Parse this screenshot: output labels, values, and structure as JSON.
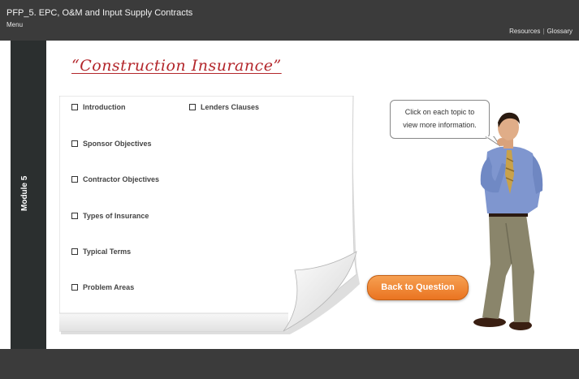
{
  "header": {
    "course_title": "PFP_5.  EPC, O&M and Input Supply Contracts",
    "menu_label": "Menu",
    "resources_label": "Resources",
    "separator": "|",
    "glossary_label": "Glossary"
  },
  "module": {
    "label": "Module 5"
  },
  "page": {
    "heading": "“Construction Insurance”"
  },
  "topics_col1": [
    "Introduction",
    "Sponsor Objectives",
    "Contractor Objectives",
    "Types of Insurance",
    "Typical Terms",
    "Problem Areas"
  ],
  "topics_col2": [
    "Lenders Clauses"
  ],
  "bubble": {
    "line1": "Click on each topic to",
    "line2": "view more information."
  },
  "back_button": {
    "label": "Back to Question"
  },
  "colors": {
    "accent_heading": "#b3262b",
    "button_orange": "#ea7421",
    "chrome_dark": "#3b3b3b"
  },
  "icons": [
    "checkbox-icon",
    "presenter-figure"
  ]
}
